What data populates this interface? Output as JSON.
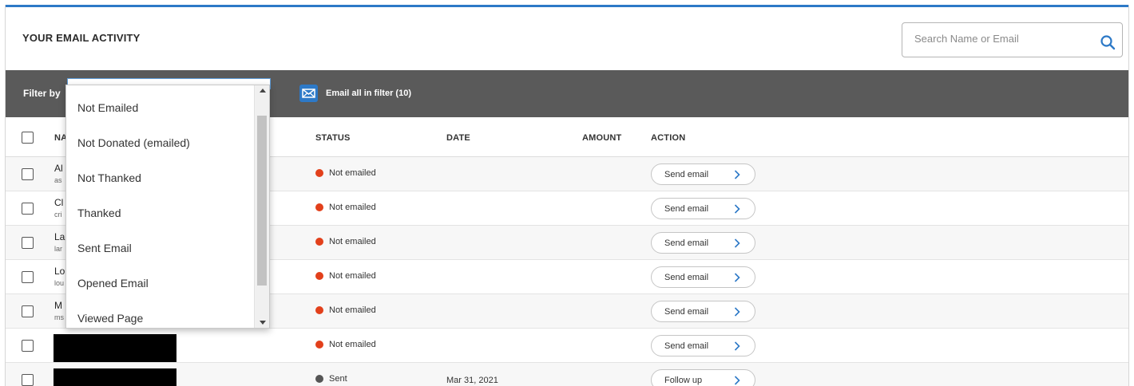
{
  "header": {
    "title": "YOUR EMAIL ACTIVITY"
  },
  "search": {
    "placeholder": "Search Name or Email",
    "value": ""
  },
  "filter": {
    "label": "Filter by",
    "email_all_label": "Email all in filter (10)"
  },
  "columns": {
    "name": "NA",
    "status": "STATUS",
    "date": "DATE",
    "amount": "AMOUNT",
    "action": "ACTION"
  },
  "dropdown": {
    "options": [
      "Not Emailed",
      "Not Donated (emailed)",
      "Not Thanked",
      "Thanked",
      "Sent Email",
      "Opened Email",
      "Viewed Page"
    ]
  },
  "rows": [
    {
      "first": "Al",
      "email": "as",
      "redacted": false,
      "status": "Not emailed",
      "status_color": "#e2401b",
      "date": "",
      "amount": "",
      "action": "Send email"
    },
    {
      "first": "Cl",
      "email": "cri",
      "redacted": false,
      "status": "Not emailed",
      "status_color": "#e2401b",
      "date": "",
      "amount": "",
      "action": "Send email"
    },
    {
      "first": "La",
      "email": "lar",
      "redacted": false,
      "status": "Not emailed",
      "status_color": "#e2401b",
      "date": "",
      "amount": "",
      "action": "Send email"
    },
    {
      "first": "Lo",
      "email": "lou",
      "redacted": false,
      "status": "Not emailed",
      "status_color": "#e2401b",
      "date": "",
      "amount": "",
      "action": "Send email"
    },
    {
      "first": "M",
      "email": "ms",
      "redacted": false,
      "status": "Not emailed",
      "status_color": "#e2401b",
      "date": "",
      "amount": "",
      "action": "Send email"
    },
    {
      "first": "",
      "email": "",
      "redacted": true,
      "status": "Not emailed",
      "status_color": "#e2401b",
      "date": "",
      "amount": "",
      "action": "Send email"
    },
    {
      "first": "",
      "email": "",
      "redacted": true,
      "status": "Sent",
      "status_color": "#555555",
      "date": "Mar 31, 2021",
      "amount": "",
      "action": "Follow up"
    }
  ],
  "colors": {
    "accent": "#2d79c7",
    "filter_bar": "#5a5a5a",
    "status_not_emailed": "#e2401b",
    "status_sent": "#555555"
  }
}
